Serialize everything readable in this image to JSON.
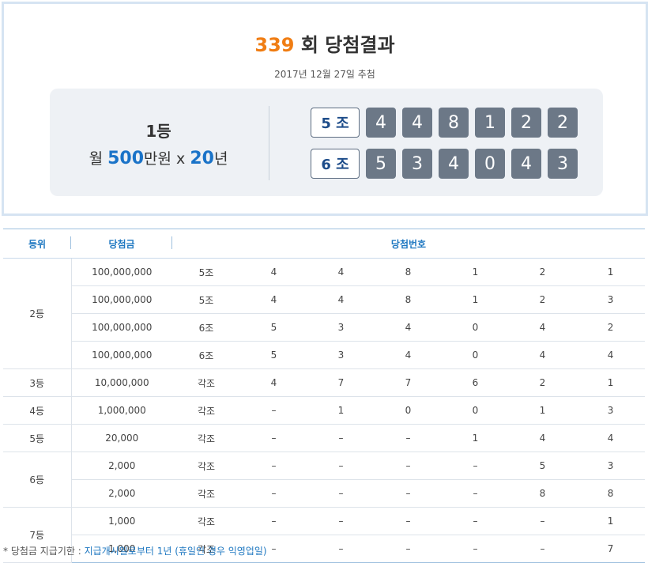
{
  "header": {
    "round": "339",
    "title_suffix": " 회 당첨결과",
    "draw_date": "2017년 12월 27일 추첨"
  },
  "first_prize": {
    "rank_label": "1등",
    "monthly_prefix": "월 ",
    "amount": "500",
    "unit": "만원 x ",
    "years": "20",
    "years_unit": "년",
    "rows": [
      {
        "group": "5 조",
        "numbers": [
          "4",
          "4",
          "8",
          "1",
          "2",
          "2"
        ]
      },
      {
        "group": "6 조",
        "numbers": [
          "5",
          "3",
          "4",
          "0",
          "4",
          "3"
        ]
      }
    ]
  },
  "table": {
    "headers": {
      "rank": "등위",
      "prize": "당첨금",
      "numbers": "당첨번호"
    },
    "groups": [
      {
        "rank": "2등",
        "rows": [
          {
            "prize": "100,000,000",
            "group": "5조",
            "nums": [
              "4",
              "4",
              "8",
              "1",
              "2",
              "1"
            ]
          },
          {
            "prize": "100,000,000",
            "group": "5조",
            "nums": [
              "4",
              "4",
              "8",
              "1",
              "2",
              "3"
            ]
          },
          {
            "prize": "100,000,000",
            "group": "6조",
            "nums": [
              "5",
              "3",
              "4",
              "0",
              "4",
              "2"
            ]
          },
          {
            "prize": "100,000,000",
            "group": "6조",
            "nums": [
              "5",
              "3",
              "4",
              "0",
              "4",
              "4"
            ]
          }
        ]
      },
      {
        "rank": "3등",
        "rows": [
          {
            "prize": "10,000,000",
            "group": "각조",
            "nums": [
              "4",
              "7",
              "7",
              "6",
              "2",
              "1"
            ]
          }
        ]
      },
      {
        "rank": "4등",
        "rows": [
          {
            "prize": "1,000,000",
            "group": "각조",
            "nums": [
              "–",
              "1",
              "0",
              "0",
              "1",
              "3"
            ]
          }
        ]
      },
      {
        "rank": "5등",
        "rows": [
          {
            "prize": "20,000",
            "group": "각조",
            "nums": [
              "–",
              "–",
              "–",
              "1",
              "4",
              "4"
            ]
          }
        ]
      },
      {
        "rank": "6등",
        "rows": [
          {
            "prize": "2,000",
            "group": "각조",
            "nums": [
              "–",
              "–",
              "–",
              "–",
              "5",
              "3"
            ]
          },
          {
            "prize": "2,000",
            "group": "각조",
            "nums": [
              "–",
              "–",
              "–",
              "–",
              "8",
              "8"
            ]
          }
        ]
      },
      {
        "rank": "7등",
        "rows": [
          {
            "prize": "1,000",
            "group": "각조",
            "nums": [
              "–",
              "–",
              "–",
              "–",
              "–",
              "1"
            ]
          },
          {
            "prize": "1,000",
            "group": "각조",
            "nums": [
              "–",
              "–",
              "–",
              "–",
              "–",
              "7"
            ]
          }
        ]
      }
    ]
  },
  "footnote": {
    "label": "* 당첨금 지급기한 : ",
    "text": "지급개시일로부터 1년 (휴일인 경우 익영업일)"
  },
  "colors": {
    "accent_orange": "#f07d13",
    "accent_blue": "#1a73c8",
    "ball_gray": "#6c7887"
  }
}
